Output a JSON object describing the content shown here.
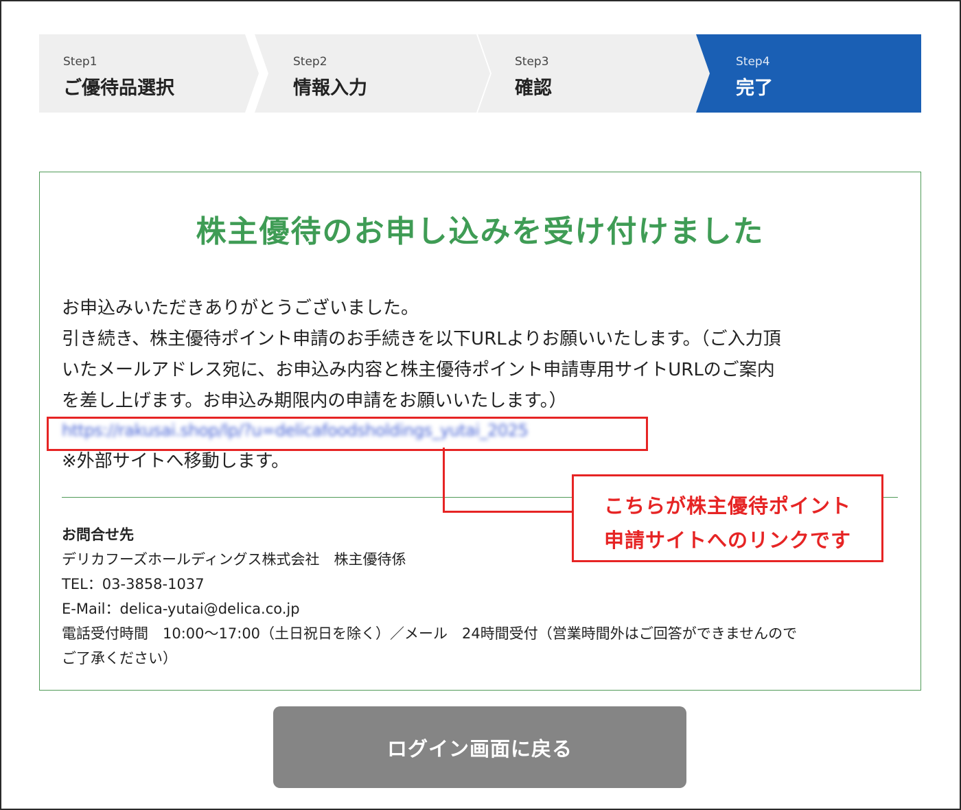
{
  "stepper": {
    "steps": [
      {
        "num": "Step1",
        "name": "ご優待品選択",
        "active": false
      },
      {
        "num": "Step2",
        "name": "情報入力",
        "active": false
      },
      {
        "num": "Step3",
        "name": "確認",
        "active": false
      },
      {
        "num": "Step4",
        "name": "完了",
        "active": true
      }
    ],
    "active_color": "#1a5fb4",
    "inactive_color": "#efefef"
  },
  "panel": {
    "title": "株主優待のお申し込みを受け付けました",
    "title_color": "#3f9c55",
    "lines": [
      "お申込みいただきありがとうございました。",
      "引き続き、株主優待ポイント申請のお手続きを以下URLよりお願いいたします。（ご入力頂",
      "いたメールアドレス宛に、お申込み内容と株主優待ポイント申請専用サイトURLのご案内",
      "を差し上げます。お申込み期限内の申請をお願いいたします。）"
    ],
    "url": "https://rakusai.shop/lp/?u=delicafoodsholdings_yutai_2025",
    "external_note": "※外部サイトへ移動します。"
  },
  "contact": {
    "heading": "お問合せ先",
    "company": "デリカフーズホールディングス株式会社　株主優待係",
    "tel": "TEL：03-3858-1037",
    "email": "E-Mail：delica-yutai@delica.co.jp",
    "hours_line1": "電話受付時間　10:00〜17:00（土日祝日を除く）／メール　24時間受付（営業時間外はご回答ができませんので",
    "hours_line2": "ご了承ください）"
  },
  "annotation": {
    "line1": "こちらが株主優待ポイント",
    "line2": "申請サイトへのリンクです",
    "color": "#e62424"
  },
  "button": {
    "label": "ログイン画面に戻る",
    "color": "#858585"
  }
}
